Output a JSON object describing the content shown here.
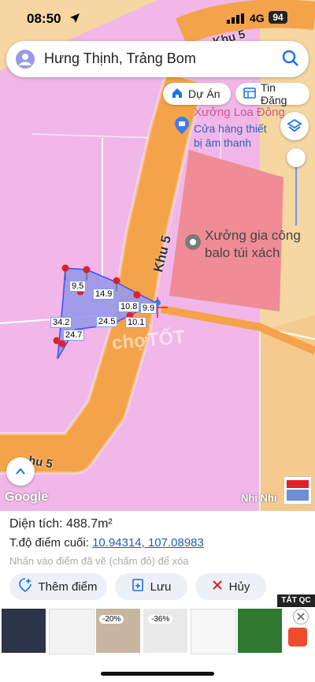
{
  "status": {
    "time": "08:50",
    "network": "4G",
    "battery": "94"
  },
  "search": {
    "query": "Hưng Thịnh, Trảng Bom"
  },
  "chips": {
    "du_an": "Dự Án",
    "tin_dang": "Tin Đăng"
  },
  "map": {
    "poi_top": "Xưởng Loa Đông",
    "store_line1": "Cửa hàng thiết",
    "store_line2": "bị âm thanh",
    "factory_line1": "Xưởng gia công",
    "factory_line2": "balo túi xách",
    "road_main": "Khu 5",
    "road_top": "Khu 5",
    "road_bottom": "hu 5",
    "google": "Google",
    "watermark": "chợTỐT",
    "nhi_nhi": "Nhi Nhí",
    "measures": [
      "9.5",
      "14.9",
      "10.8",
      "9.9",
      "10.1",
      "24.5",
      "34.2",
      "24.7"
    ]
  },
  "panel": {
    "area_label": "Diện tích:",
    "area_value": "488.7m²",
    "coord_label": "T.độ điểm cuối:",
    "coord_value": "10.94314, 107.08983",
    "hint": "Nhấn vào điểm đã vẽ (chấm đỏ) để xóa",
    "btn_add": "Thêm điểm",
    "btn_save": "Lưu",
    "btn_cancel": "Hủy"
  },
  "ads": {
    "label": "TẮT QC",
    "discount1": "-20%",
    "discount2": "-36%"
  },
  "colors": {
    "plot_pink": "#f1b7e8",
    "road": "#f4a34a",
    "factory": "#f08c96",
    "polygon": "#9a98e8",
    "accent": "#1a73e8"
  }
}
